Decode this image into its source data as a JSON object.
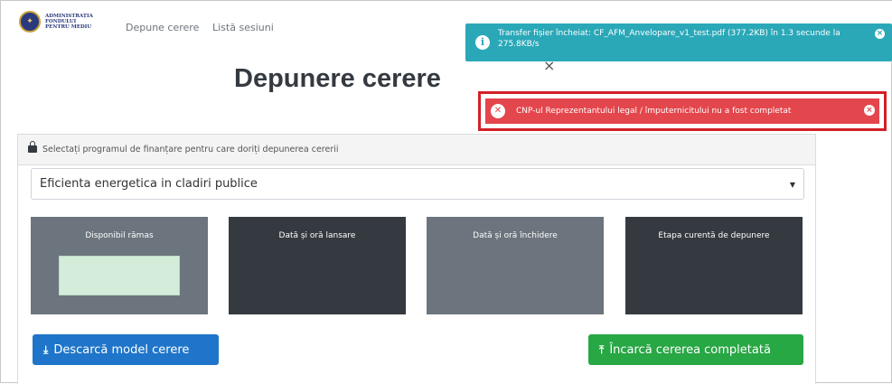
{
  "nav": {
    "brand_lines": [
      "ADMINISTRAȚIA",
      "FONDULUI",
      "PENTRU MEDIU"
    ],
    "links": [
      "Depune cerere",
      "Listă sesiuni"
    ]
  },
  "page_title": "Depunere cerere",
  "toasts": {
    "info": {
      "icon": "info-icon",
      "message": "Transfer fișier încheiat: CF_AFM_Anvelopare_v1_test.pdf (377.2KB) în 1.3 secunde la 275.8KB/s",
      "color": "#2aa8b8"
    },
    "error": {
      "icon": "x-circle-icon",
      "message": "CNP-ul Reprezentantului legal / împuternicitului nu a fost completat",
      "color": "#e3464c",
      "highlight_border": "#d31f28"
    }
  },
  "card": {
    "header_text": "Selectați programul de finanțare pentru care doriți depunerea cererii",
    "program_select": {
      "value": "Eficienta energetica in cladiri publice"
    },
    "tiles": [
      {
        "label": "Disponibil rămas"
      },
      {
        "label": "Dată și oră lansare"
      },
      {
        "label": "Dată și oră închidere"
      },
      {
        "label": "Etapa curentă de depunere"
      }
    ],
    "download_button": "Descarcă model cerere",
    "upload_button": "Încarcă cererea completată"
  },
  "colors": {
    "primary": "#1f75c9",
    "success": "#28a745",
    "tile_gray": "#6c757d",
    "tile_dark": "#343a40"
  }
}
